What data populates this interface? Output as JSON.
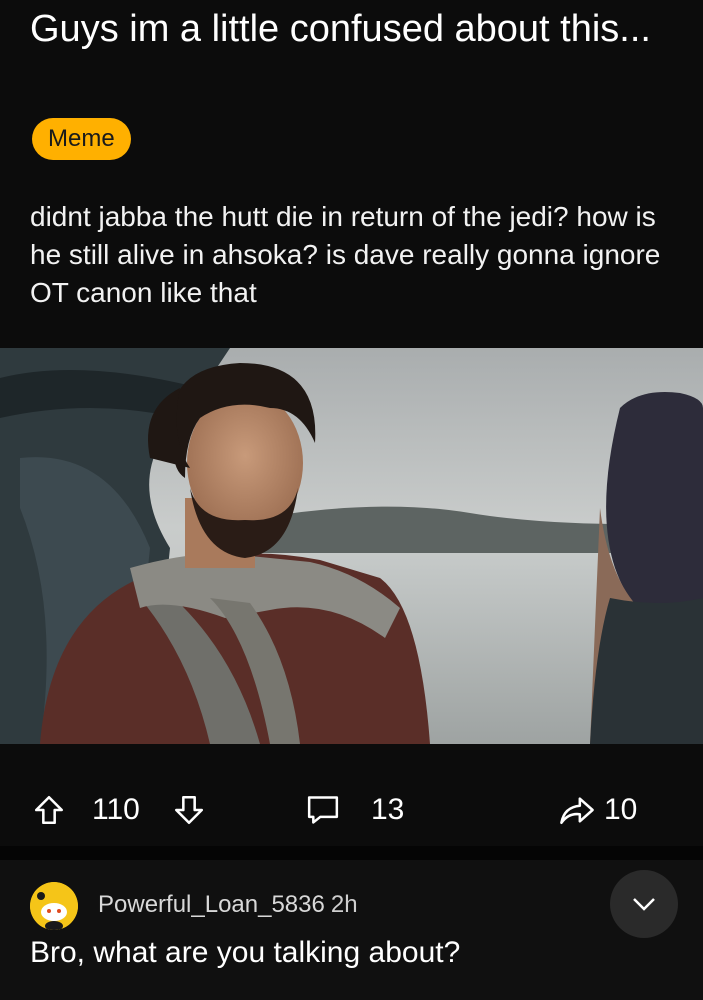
{
  "post": {
    "title": "Guys im a little confused about this...",
    "flair": "Meme",
    "flair_color": "#ffb000",
    "body": "didnt jabba the hutt die in return of the jedi? how is he still alive in ahsoka? is dave really gonna ignore OT canon like that"
  },
  "actions": {
    "upvote_count": "110",
    "comment_count": "13",
    "share_count": "10",
    "icons": [
      "upvote-arrow-icon",
      "downvote-arrow-icon",
      "comment-bubble-icon",
      "share-arrow-icon"
    ]
  },
  "comment": {
    "author": "Powerful_Loan_5836",
    "time": "2h",
    "text": "Bro, what are you talking about?",
    "avatar_color": "#f5c518",
    "collapse_icon": "chevron-down-icon"
  }
}
